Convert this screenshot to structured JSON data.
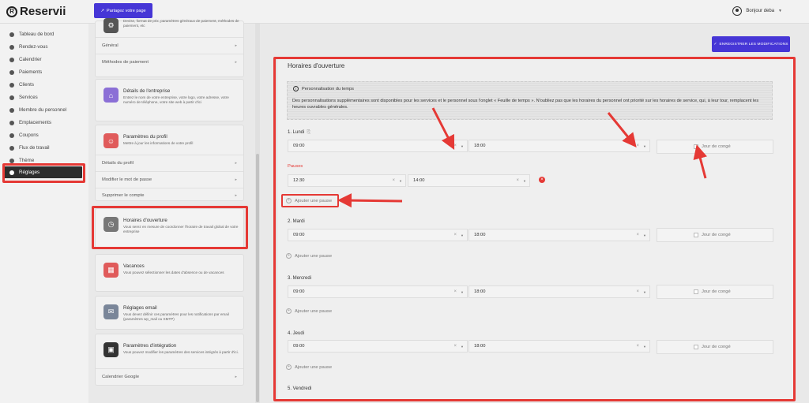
{
  "brand": {
    "name": "Reservii"
  },
  "topbar": {
    "share_label": "Partagez votre page",
    "greeting": "Bonjour deba"
  },
  "sidebar": {
    "items": [
      {
        "label": "Tableau de bord",
        "icon": "dashboard-icon"
      },
      {
        "label": "Rendez-vous",
        "icon": "clock-icon"
      },
      {
        "label": "Calendrier",
        "icon": "calendar-icon"
      },
      {
        "label": "Paiements",
        "icon": "wallet-icon"
      },
      {
        "label": "Clients",
        "icon": "users-icon"
      },
      {
        "label": "Services",
        "icon": "list-icon"
      },
      {
        "label": "Membre du personnel",
        "icon": "user-icon"
      },
      {
        "label": "Emplacements",
        "icon": "location-icon"
      },
      {
        "label": "Coupons",
        "icon": "tag-icon"
      },
      {
        "label": "Flux de travail",
        "icon": "workflow-icon"
      },
      {
        "label": "Thème",
        "icon": "brush-icon"
      },
      {
        "label": "Réglages",
        "icon": "gear-icon",
        "active": true
      }
    ]
  },
  "settings": {
    "card0": {
      "desc": "Devise, format de prix, paramètres généraux de paiement, méthodes de paiement, etc",
      "accordions": [
        {
          "label": "Général"
        },
        {
          "label": "Méthodes de paiement"
        }
      ]
    },
    "card1": {
      "title": "Détails de l'entreprise",
      "desc": "Entrez le nom de votre entreprise, votre logo, votre adresse, votre numéro de téléphone, votre site web à partir d'ici"
    },
    "card2": {
      "title": "Paramètres du profil",
      "desc": "Mettre à jour les informations de votre profil",
      "accordions": [
        {
          "label": "Détails du profil"
        },
        {
          "label": "Modifier le mot de passe"
        },
        {
          "label": "Supprimer le compte"
        }
      ]
    },
    "card3": {
      "title": "Horaires d'ouverture",
      "desc": "Vous serez en mesure de coordonner l'horaire de travail global de votre entreprise"
    },
    "card4": {
      "title": "Vacances",
      "desc": "Vous pouvez sélectionner les dates d'absence ou de vacances"
    },
    "card5": {
      "title": "Réglages email",
      "desc": "Vous devez définir ces paramètres pour les notifications par email (paramètres wp_mail ou SMTP)"
    },
    "card6": {
      "title": "Paramètres d'intégration",
      "desc": "Vous pouvez modifier les paramètres des services intégrés à partir d'ici.",
      "accordions": [
        {
          "label": "Calendrier Google"
        }
      ]
    }
  },
  "main": {
    "save_label": "ENREGISTRER LES MODIFICATIONS",
    "panel_title": "Horaires d'ouverture",
    "info": {
      "title": "Personnalisation du temps",
      "text": "Des personnalisations supplémentaires sont disponibles pour les services et le personnel sous l'onglet « Feuille de temps ». N'oubliez pas que les horaires du personnel ont priorité sur les horaires de service, qui, à leur tour, remplacent les heures ouvrables générales."
    },
    "days": [
      {
        "label": "1. Lundi",
        "start": "09:00",
        "end": "18:00",
        "off_label": "Jour de congé",
        "add_pause": "Ajouter une pause"
      },
      {
        "label": "2. Mardi",
        "start": "09:00",
        "end": "18:00",
        "off_label": "Jour de congé",
        "add_pause": "Ajouter une pause"
      },
      {
        "label": "3. Mercredi",
        "start": "09:00",
        "end": "18:00",
        "off_label": "Jour de congé",
        "add_pause": "Ajouter une pause"
      },
      {
        "label": "4. Jeudi",
        "start": "09:00",
        "end": "18:00",
        "off_label": "Jour de congé",
        "add_pause": "Ajouter une pause"
      },
      {
        "label": "5. Vendredi"
      }
    ],
    "pauses_label": "Pauses",
    "pause": {
      "start": "12:30",
      "end": "14:00"
    }
  },
  "colors": {
    "accent": "#4636d6",
    "highlight": "#e53935",
    "active_nav": "#2d2d2d"
  }
}
